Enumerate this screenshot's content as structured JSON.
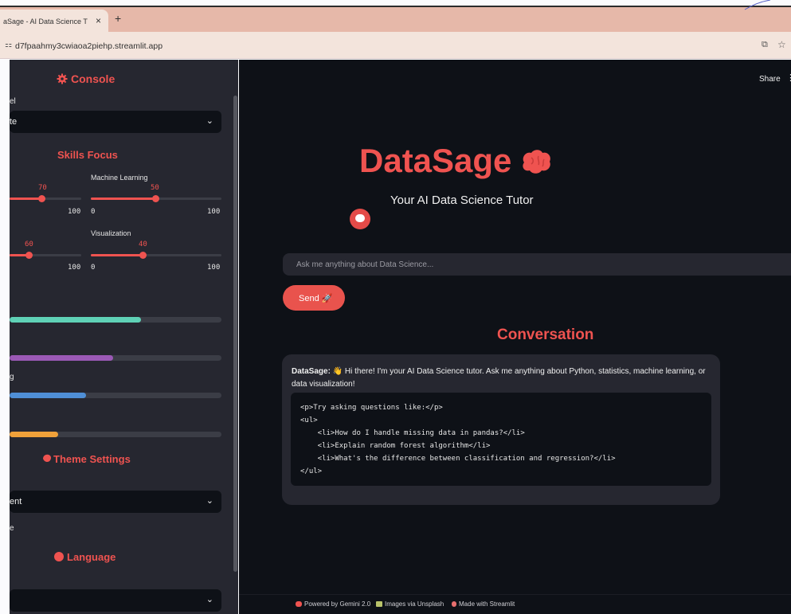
{
  "browser": {
    "tab_title": "aSage - AI Data Science T",
    "tab_close": "×",
    "new_tab": "+",
    "url": "d7fpaahmy3cwiaoa2piehp.streamlit.app",
    "url_icon": "⚏",
    "ext_icon": "⧉",
    "star_icon": "☆"
  },
  "sidebar": {
    "console_title": "Console",
    "model_label": "el",
    "model_value": "te",
    "skills_title": "Skills Focus",
    "sliders": [
      {
        "label": "",
        "value": 70,
        "min_label": "",
        "max_label": "100"
      },
      {
        "label": "Machine Learning",
        "value": 50,
        "min_label": "0",
        "max_label": "100"
      },
      {
        "label": "",
        "value": 60,
        "min_label": "",
        "max_label": "100"
      },
      {
        "label": "Visualization",
        "value": 40,
        "min_label": "0",
        "max_label": "100"
      }
    ],
    "progress": [
      {
        "label": "",
        "fraction": 0.62,
        "color": "#5fd1b6"
      },
      {
        "label": "",
        "fraction": 0.49,
        "color": "#9b59b6"
      },
      {
        "label": "g",
        "fraction": 0.36,
        "color": "#4f8fd6"
      },
      {
        "label": "",
        "fraction": 0.23,
        "color": "#f0a13a"
      }
    ],
    "theme_title": "Theme Settings",
    "theme_value": "ent",
    "theme_extra": "e",
    "language_title": "Language",
    "language_value": "",
    "chevron": "⌄"
  },
  "main": {
    "share": "Share",
    "share_more": "⋮",
    "title": "DataSage",
    "subtitle": "Your AI Data Science Tutor",
    "ask_placeholder": "Ask me anything about Data Science...",
    "send_label": "Send 🚀",
    "conversation_title": "Conversation",
    "message": {
      "sender": "DataSage:",
      "text": " 👋 Hi there! I'm your AI Data Science tutor. Ask me anything about Python, statistics, machine learning, or data visualization!",
      "code_lines": [
        "<p>Try asking questions like:</p>",
        "<ul>",
        "    <li>How do I handle missing data in pandas?</li>",
        "    <li>Explain random forest algorithm</li>",
        "    <li>What's the difference between classification and regression?</li>",
        "</ul>"
      ]
    }
  },
  "footer": {
    "gemini": "Powered by Gemini 2.0",
    "unsplash": "Images via Unsplash",
    "streamlit": "Made with Streamlit"
  },
  "colors": {
    "accent": "#ef5350",
    "sidebar_bg": "#262730",
    "main_bg": "#0e1117"
  }
}
